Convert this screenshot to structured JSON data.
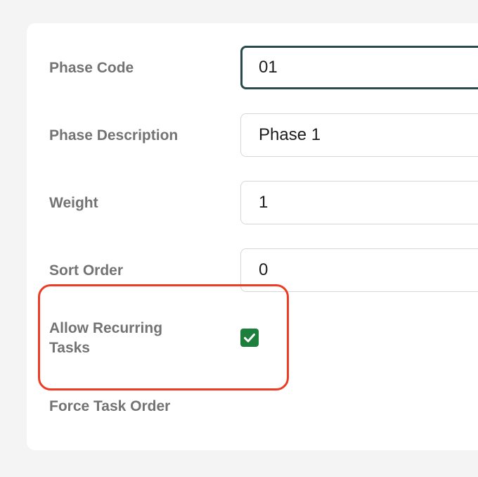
{
  "form": {
    "phase_code": {
      "label": "Phase Code",
      "value": "01"
    },
    "phase_description": {
      "label": "Phase Description",
      "value": "Phase 1"
    },
    "weight": {
      "label": "Weight",
      "value": "1"
    },
    "sort_order": {
      "label": "Sort Order",
      "value": "0"
    },
    "allow_recurring_tasks": {
      "label_line1": "Allow Recurring",
      "label_line2": "Tasks",
      "checked": true
    },
    "force_task_order": {
      "label": "Force Task Order"
    }
  },
  "colors": {
    "checkbox_checked": "#1d7f3c",
    "focus_border": "#2a4b4e",
    "highlight": "#ef3a24"
  }
}
